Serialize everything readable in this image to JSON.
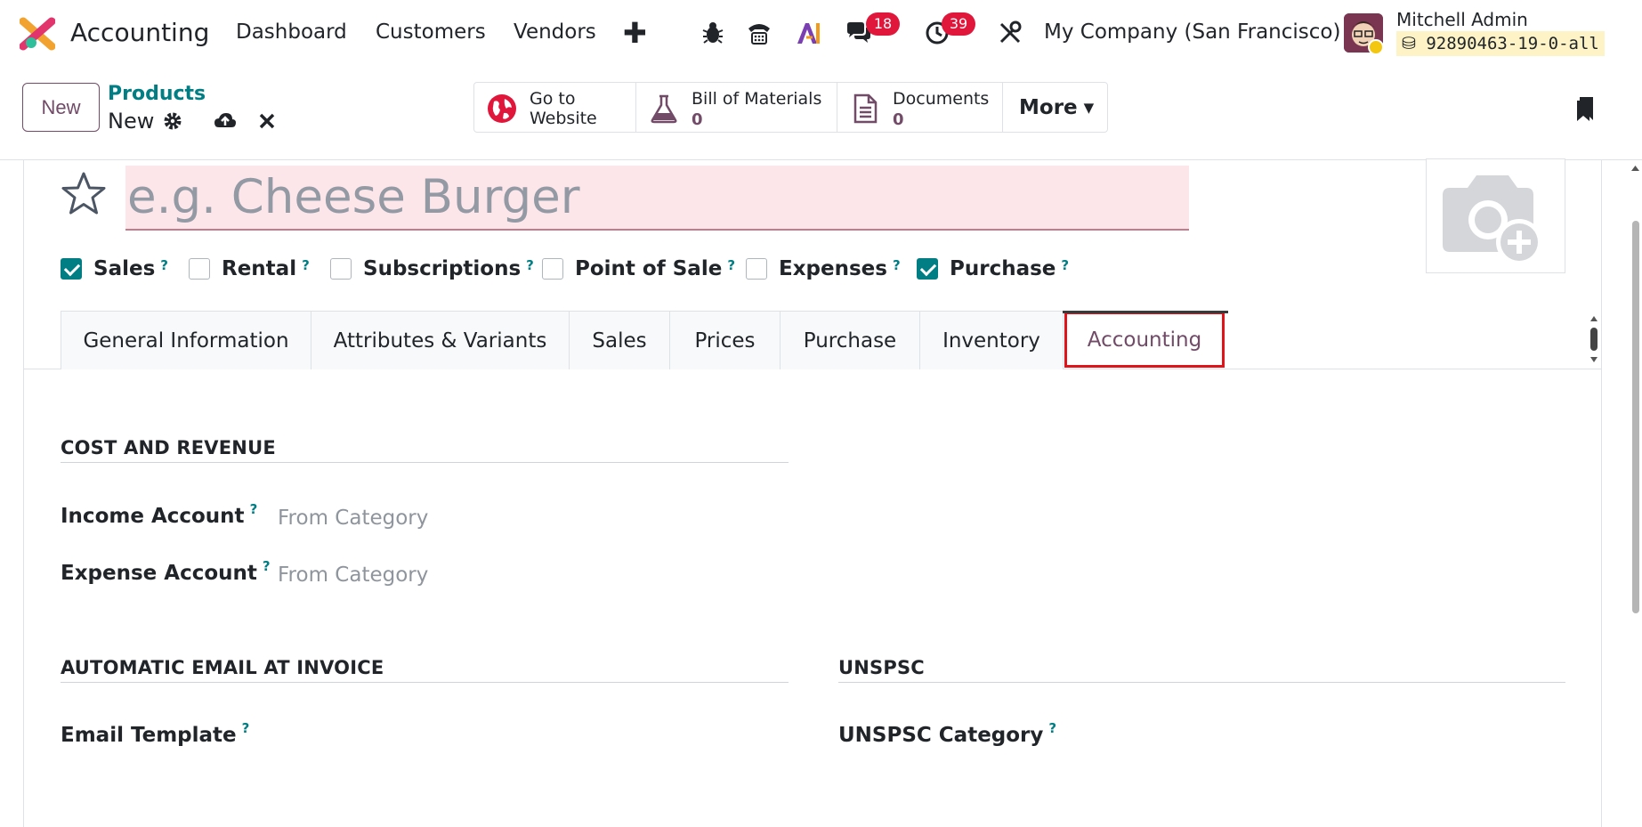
{
  "app": {
    "title": "Accounting"
  },
  "nav": {
    "items": [
      "Dashboard",
      "Customers",
      "Vendors"
    ]
  },
  "systray": {
    "messages_count": "18",
    "activities_count": "39",
    "company": "My Company (San Francisco)",
    "user_name": "Mitchell Admin",
    "database": "92890463-19-0-all"
  },
  "control": {
    "new_label": "New",
    "breadcrumb_parent": "Products",
    "breadcrumb_current": "New"
  },
  "smart_buttons": {
    "website_line1": "Go to",
    "website_line2": "Website",
    "bom_label": "Bill of Materials",
    "bom_count": "0",
    "documents_label": "Documents",
    "documents_count": "0",
    "more_label": "More"
  },
  "product": {
    "name_placeholder": "e.g. Cheese Burger",
    "flags": [
      {
        "label": "Sales",
        "checked": true
      },
      {
        "label": "Rental",
        "checked": false
      },
      {
        "label": "Subscriptions",
        "checked": false
      },
      {
        "label": "Point of Sale",
        "checked": false
      },
      {
        "label": "Expenses",
        "checked": false
      },
      {
        "label": "Purchase",
        "checked": true
      }
    ]
  },
  "tabs": [
    "General Information",
    "Attributes & Variants",
    "Sales",
    "Prices",
    "Purchase",
    "Inventory",
    "Accounting"
  ],
  "active_tab": "Accounting",
  "accounting": {
    "cost_revenue_title": "COST AND REVENUE",
    "income_label": "Income Account",
    "income_value": "From Category",
    "expense_label": "Expense Account",
    "expense_value": "From Category",
    "auto_email_title": "AUTOMATIC EMAIL AT INVOICE",
    "email_template_label": "Email Template",
    "unspsc_title": "UNSPSC",
    "unspsc_category_label": "UNSPSC Category"
  },
  "help_marker": "?",
  "colors": {
    "brand": "#714B67",
    "teal": "#017e84",
    "badge": "#e0163b",
    "highlight": "#e0131a"
  }
}
